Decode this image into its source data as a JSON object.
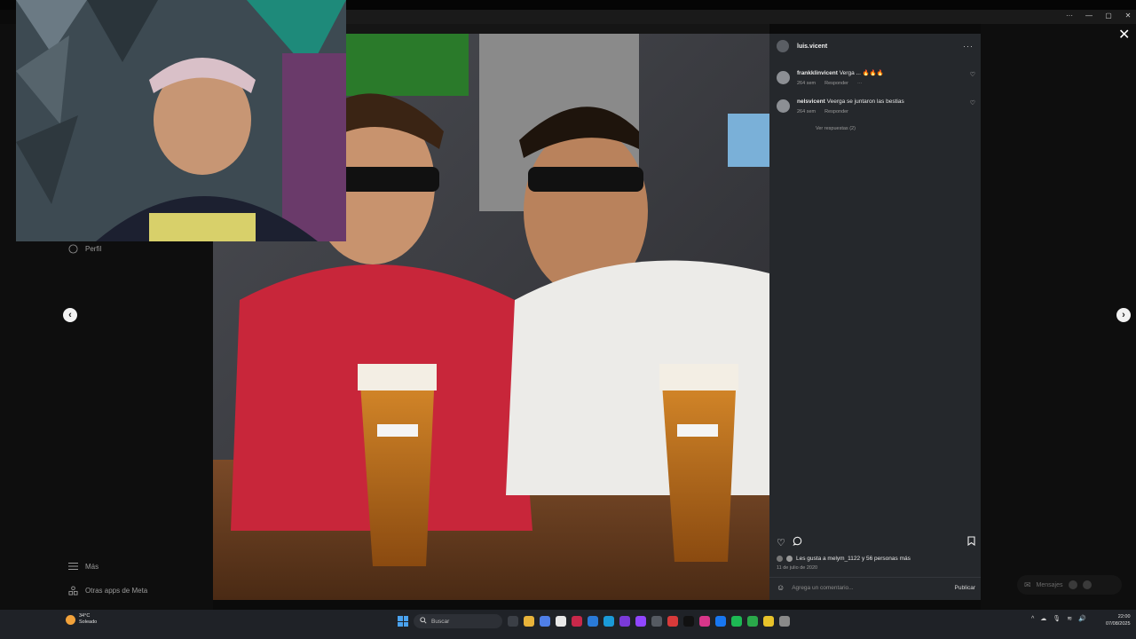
{
  "window": {
    "controls": [
      "···",
      "—",
      "▢",
      "✕"
    ]
  },
  "sidebar": {
    "profile_label": "Perfil",
    "more_label": "Más",
    "meta_apps_label": "Otras apps de Meta"
  },
  "navigation": {
    "prev_arrow": "‹",
    "next_arrow": "›",
    "close": "✕"
  },
  "post": {
    "username": "luis.vicent",
    "more": "···",
    "comments": [
      {
        "user": "frankklinvicent",
        "text": "Verga ... 🔥🔥🔥",
        "time": "264 sem",
        "reply": "Responder",
        "extra": "···"
      },
      {
        "user": "nelsvicent",
        "text": "Veerga se juntaron las bestias",
        "time": "264 sem",
        "reply": "Responder",
        "extra": ""
      }
    ],
    "view_replies": "Ver respuestas (2)",
    "likes_text": "Les gusta a melym_1122 y 56 personas más",
    "date": "11 de julio de 2020",
    "comment_placeholder": "Agrega un comentario...",
    "publish_label": "Publicar"
  },
  "messages": {
    "label": "Mensajes"
  },
  "taskbar": {
    "weather_temp": "34°C",
    "weather_desc": "Soleado",
    "search_placeholder": "Buscar",
    "time": "22:00",
    "date": "07/08/2025"
  },
  "colors": {
    "panel_bg": "#25282c",
    "taskbar_bg": "#1f2227",
    "accent_blue": "#4aa3f0"
  }
}
